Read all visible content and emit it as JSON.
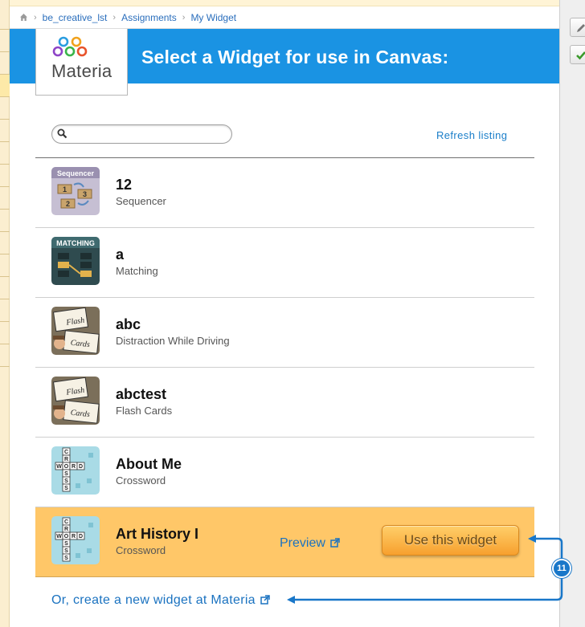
{
  "breadcrumb": {
    "items": [
      "be_creative_lst",
      "Assignments",
      "My Widget"
    ]
  },
  "header": {
    "title": "Select a Widget for use in Canvas:",
    "logo_text": "Materia"
  },
  "search": {
    "value": "",
    "placeholder": ""
  },
  "refresh_label": "Refresh listing",
  "widgets": [
    {
      "name": "12",
      "type": "Sequencer",
      "icon": "sequencer-icon"
    },
    {
      "name": "a",
      "type": "Matching",
      "icon": "matching-icon"
    },
    {
      "name": "abc",
      "type": "Distraction While Driving",
      "icon": "flashcards-icon"
    },
    {
      "name": "abctest",
      "type": "Flash Cards",
      "icon": "flashcards-icon"
    },
    {
      "name": "About Me",
      "type": "Crossword",
      "icon": "crossword-icon"
    },
    {
      "name": "Art History I",
      "type": "Crossword",
      "icon": "crossword-icon",
      "selected": true
    }
  ],
  "selected_row": {
    "preview_label": "Preview",
    "use_label": "Use this widget"
  },
  "create_link": "Or, create a new widget at Materia",
  "annotation": {
    "badge": "11",
    "color": "#1977c9"
  },
  "colors": {
    "header_bg": "#1a93e3",
    "selected_bg": "#ffc768",
    "button": "#f7a02e",
    "link": "#1a72c0"
  }
}
